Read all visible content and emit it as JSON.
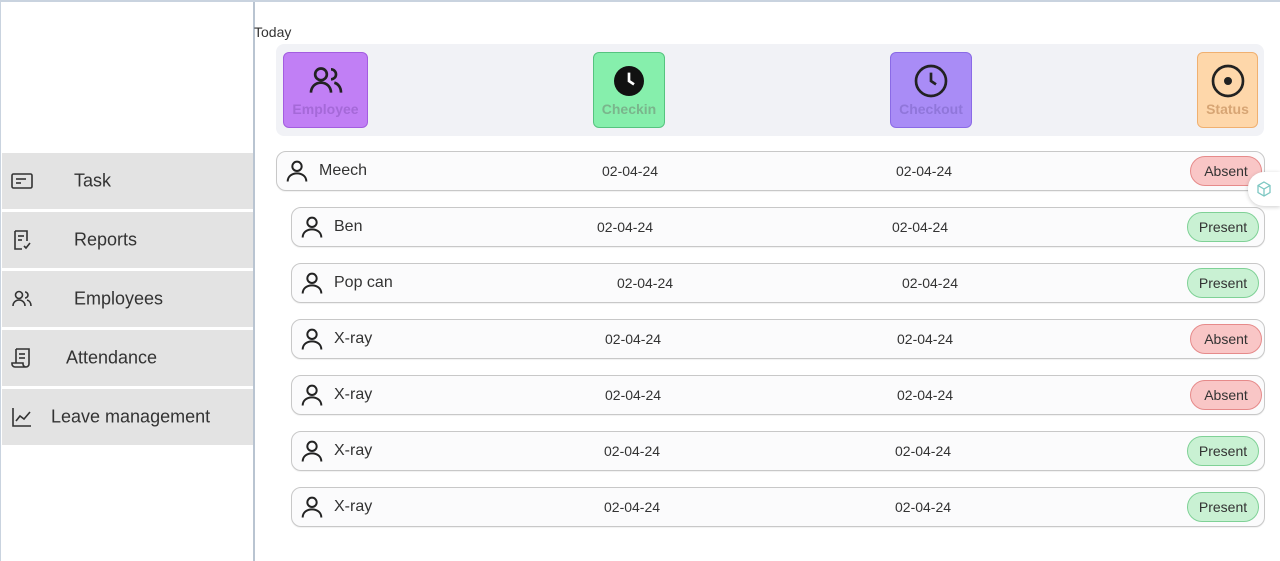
{
  "sidebar": {
    "items": [
      {
        "label": "Task",
        "icon": "task-icon"
      },
      {
        "label": "Reports",
        "icon": "reports-icon"
      },
      {
        "label": "Employees",
        "icon": "employees-icon"
      },
      {
        "label": "Attendance",
        "icon": "attendance-icon"
      },
      {
        "label": "Leave management",
        "icon": "chart-icon"
      }
    ]
  },
  "section_title": "Today",
  "header": {
    "employee": {
      "label": "Employee",
      "color": "#c17ff5"
    },
    "checkin": {
      "label": "Checkin",
      "color": "#86efac"
    },
    "checkout": {
      "label": "Checkout",
      "color": "#a98cf6"
    },
    "status": {
      "label": "Status",
      "color": "#fed7aa"
    }
  },
  "rows": [
    {
      "name": "Meech",
      "checkin": "02-04-24",
      "checkout": "02-04-24",
      "status": "Absent"
    },
    {
      "name": "Ben",
      "checkin": "02-04-24",
      "checkout": "02-04-24",
      "status": "Present"
    },
    {
      "name": "Pop can",
      "checkin": "02-04-24",
      "checkout": "02-04-24",
      "status": "Present"
    },
    {
      "name": "X-ray",
      "checkin": "02-04-24",
      "checkout": "02-04-24",
      "status": "Absent"
    },
    {
      "name": "X-ray",
      "checkin": "02-04-24",
      "checkout": "02-04-24",
      "status": "Absent"
    },
    {
      "name": "X-ray",
      "checkin": "02-04-24",
      "checkout": "02-04-24",
      "status": "Present"
    },
    {
      "name": "X-ray",
      "checkin": "02-04-24",
      "checkout": "02-04-24",
      "status": "Present"
    }
  ]
}
